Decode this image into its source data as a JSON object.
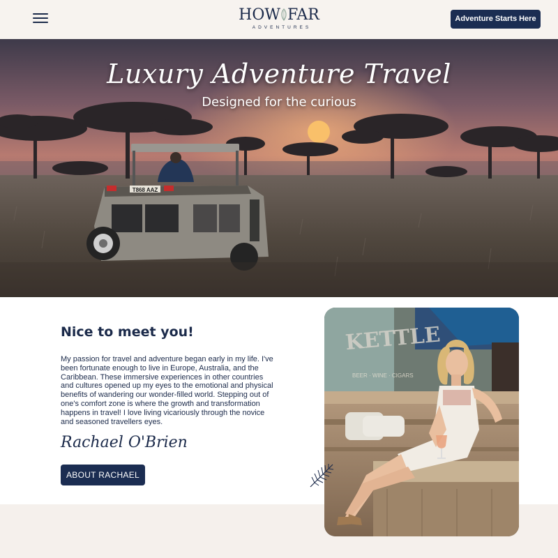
{
  "header": {
    "logo_main_left": "HOW",
    "logo_main_right": "FAR",
    "logo_sub": "ADVENTURES",
    "cta_label": "Adventure Starts Here"
  },
  "hero": {
    "title": "Luxury Adventure Travel",
    "subtitle": "Designed for the curious",
    "plate_text": "T868 AAZ"
  },
  "intro": {
    "heading": "Nice to meet you!",
    "body": "My passion for travel and adventure began early in my life. I've been fortunate enough to live in Europe, Australia, and the Caribbean. These immersive experiences in other countries and cultures opened up my eyes to the emotional and physical benefits of wandering our wonder-filled world. Stepping out of one's comfort zone is where the growth and transformation happens in travel! I love living vicariously through the novice and seasoned travellers eyes.",
    "signature": "Rachael O'Brien",
    "button_label": "ABOUT RACHAEL"
  },
  "photo": {
    "sign_text": "KETTLE",
    "sign_sub": "BEER · WINE · CIGARS"
  },
  "colors": {
    "navy": "#1b2d52",
    "cream": "#f5f0ec",
    "white": "#ffffff"
  },
  "icons": [
    "menu-icon",
    "palm-leaf-icon"
  ]
}
